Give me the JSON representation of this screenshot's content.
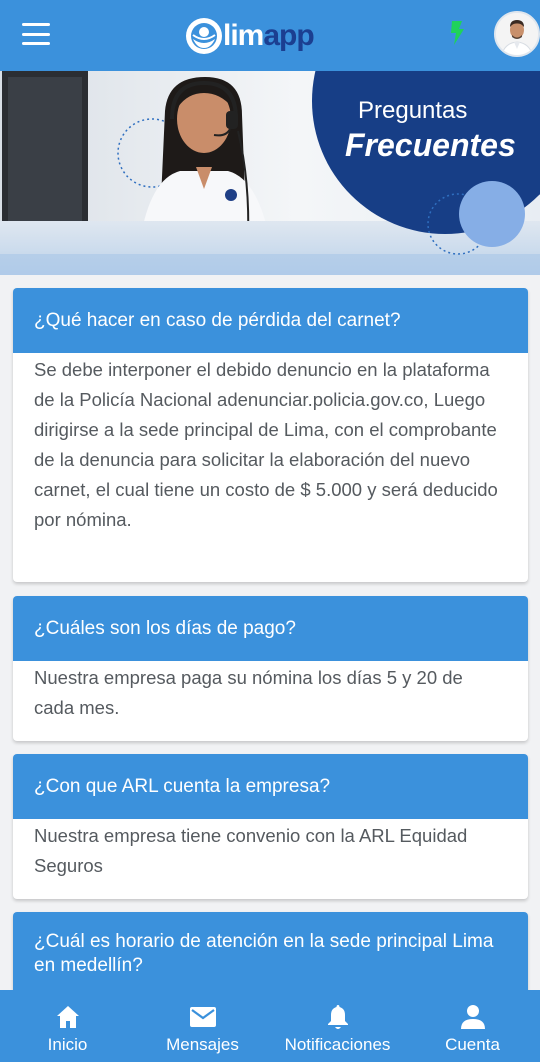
{
  "header": {
    "menu_icon": "hamburger-menu-icon",
    "logo": {
      "part1": "lim",
      "part2": "app"
    },
    "status_icon": "green-status-indicator-icon",
    "avatar_icon": "user-avatar",
    "colors": {
      "bar": "#3b91dc",
      "logo_dark": "#1b3f91",
      "status": "#1fd25a"
    }
  },
  "banner": {
    "title_line1": "Preguntas",
    "title_line2": "Frecuentes",
    "colors": {
      "circle_dark": "#173e86",
      "circle_light": "#86aee6"
    }
  },
  "faqs": [
    {
      "question": "¿Qué hacer en caso de pérdida del carnet?",
      "answer": "Se debe interponer el debido denuncio en la plataforma de la Policía Nacional adenunciar.policia.gov.co, Luego dirigirse a la sede principal de Lima, con el comprobante de la denuncia para solicitar la elaboración del nuevo carnet, el cual tiene un costo de $ 5.000 y será deducido por nómina."
    },
    {
      "question": "¿Cuáles son los días de pago?",
      "answer": "Nuestra empresa paga su nómina los días 5 y 20 de cada mes."
    },
    {
      "question": "¿Con que ARL cuenta la empresa?",
      "answer": "Nuestra empresa tiene convenio con la ARL Equidad Seguros"
    },
    {
      "question": "¿Cuál es horario de atención en la sede principal Lima en medellín?",
      "answer": ""
    }
  ],
  "bottom_nav": {
    "items": [
      {
        "label": "Inicio",
        "icon": "home-icon"
      },
      {
        "label": "Mensajes",
        "icon": "mail-icon"
      },
      {
        "label": "Notificaciones",
        "icon": "bell-icon"
      },
      {
        "label": "Cuenta",
        "icon": "person-icon"
      }
    ]
  }
}
